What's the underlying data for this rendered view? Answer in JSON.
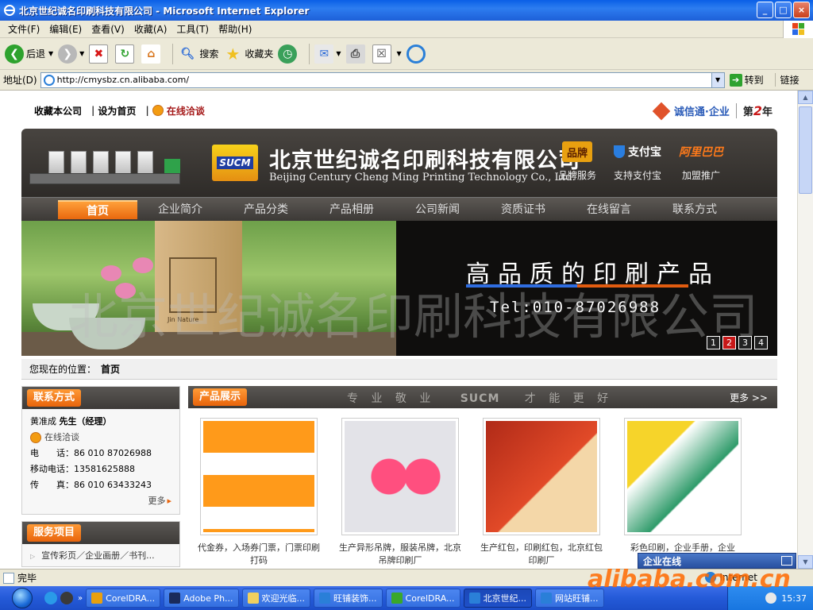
{
  "window": {
    "title": "北京世纪诚名印刷科技有限公司 - Microsoft Internet Explorer",
    "buttons": {
      "minimize": "_",
      "maximize": "□",
      "close": "×"
    }
  },
  "menubar": [
    "文件(F)",
    "编辑(E)",
    "查看(V)",
    "收藏(A)",
    "工具(T)",
    "帮助(H)"
  ],
  "toolbar": {
    "back": "后退",
    "search": "搜索",
    "favorites": "收藏夹"
  },
  "address": {
    "label": "地址(D)",
    "url": "http://cmysbz.cn.alibaba.com/",
    "go": "转到",
    "links": "链接"
  },
  "site": {
    "topnav": {
      "bookmark": "收藏本公司",
      "sethome": "设为首页",
      "chat": "在线洽谈",
      "cert_name": "诚信通·企业",
      "cert_year_prefix": "第",
      "cert_year_num": "2",
      "cert_year_suffix": "年"
    },
    "header": {
      "logo_text": "SUCM",
      "company_cn": "北京世纪诚名印刷科技有限公司",
      "company_en": "Beijing Century Cheng Ming Printing Technology Co., Ltd.",
      "badges": [
        {
          "icon": "品牌",
          "label": "品牌服务"
        },
        {
          "icon": "支付宝",
          "label": "支持支付宝"
        },
        {
          "icon": "阿里巴巴",
          "label": "加盟推广"
        }
      ]
    },
    "nav": [
      "首页",
      "企业简介",
      "产品分类",
      "产品相册",
      "公司新闻",
      "资质证书",
      "在线留言",
      "联系方式"
    ],
    "banner": {
      "slogan": "高品质的印刷产品",
      "tel": "Tel:010-87026988",
      "watermark": "北京世纪诚名印刷科技有限公司",
      "bag_text": "Jin Nature",
      "pages": [
        "1",
        "2",
        "3",
        "4"
      ],
      "active_page": 2
    },
    "breadcrumb": {
      "label": "您现在的位置：",
      "current": "首页"
    },
    "contact": {
      "title": "联系方式",
      "name": "黄准成",
      "name_title": "先生（经理）",
      "chat": "在线洽谈",
      "phone_label": "电　　话：",
      "phone": "86 010 87026988",
      "mobile_label": "移动电话：",
      "mobile": "13581625888",
      "fax_label": "传　　真：",
      "fax": "86 010 63433243",
      "more": "更多"
    },
    "services": {
      "title": "服务项目",
      "item": "宣传彩页／企业画册／书刊..."
    },
    "products": {
      "title": "产品展示",
      "motto_left": "专 业 敬 业",
      "motto_logo": "SUCM",
      "motto_right": "才 能 更 好",
      "more": "更多 >>",
      "items": [
        {
          "caption": "代金券，入场券门票，门票印刷打码"
        },
        {
          "caption": "生产异形吊牌，服装吊牌，北京吊牌印刷厂"
        },
        {
          "caption": "生产红包，印刷红包，北京红包印刷厂"
        },
        {
          "caption": "彩色印刷，企业手册，企业"
        }
      ]
    },
    "qq": "企业在线"
  },
  "status": {
    "text": "完毕",
    "zone": "Internet"
  },
  "watermark_brand": "alibaba.com.cn",
  "taskbar": {
    "tasks": [
      "CorelDRA...",
      "Adobe Ph...",
      "欢迎光临...",
      "旺铺装饰...",
      "CorelDRA...",
      "北京世纪...",
      "网站旺铺..."
    ],
    "active_task": 5,
    "clock": "15:37"
  }
}
